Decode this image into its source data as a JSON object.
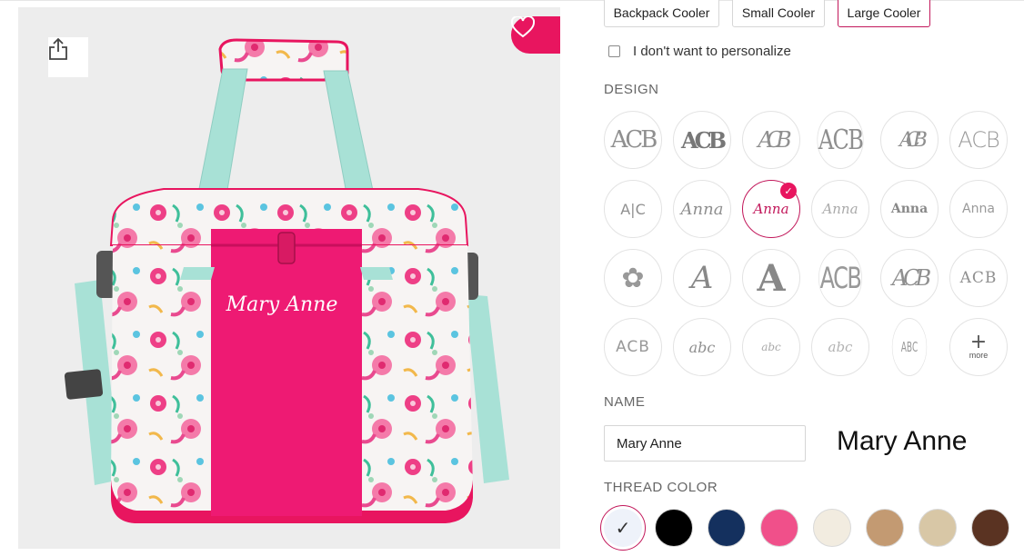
{
  "product_image": {
    "personalized_text": "Mary Anne"
  },
  "size_options": [
    {
      "label": "Backpack Cooler",
      "selected": false
    },
    {
      "label": "Small Cooler",
      "selected": false
    },
    {
      "label": "Large Cooler",
      "selected": true
    }
  ],
  "personalize": {
    "label": "I don't want to personalize",
    "checked": false
  },
  "design": {
    "label": "DESIGN",
    "options": [
      {
        "text": "ACB",
        "icon": "monogram-serif-icon"
      },
      {
        "text": "ACB",
        "icon": "monogram-bold-icon"
      },
      {
        "text": "ACB",
        "icon": "monogram-interlock-icon"
      },
      {
        "text": "ACB",
        "icon": "monogram-tall-icon"
      },
      {
        "text": "ACB",
        "icon": "monogram-vine-icon"
      },
      {
        "text": "ACB",
        "icon": "monogram-thin-icon"
      },
      {
        "text": "A|C",
        "icon": "monogram-split-icon"
      },
      {
        "text": "Anna",
        "icon": "script-anna-icon"
      },
      {
        "text": "Anna",
        "icon": "script-anna-selected-icon",
        "selected": true
      },
      {
        "text": "Anna",
        "icon": "script-thin-anna-icon"
      },
      {
        "text": "Anna",
        "icon": "serif-anna-icon"
      },
      {
        "text": "Anna",
        "icon": "print-anna-icon"
      },
      {
        "text": "✿",
        "icon": "flourish-icon"
      },
      {
        "text": "A",
        "icon": "script-initial-icon"
      },
      {
        "text": "A",
        "icon": "block-initial-icon"
      },
      {
        "text": "ACB",
        "icon": "monogram-outline-icon"
      },
      {
        "text": "ACB",
        "icon": "monogram-loop-icon"
      },
      {
        "text": "ACB",
        "icon": "monogram-smallcaps-icon"
      },
      {
        "text": "ACB",
        "icon": "monogram-block-icon"
      },
      {
        "text": "abc",
        "icon": "script-abc-icon"
      },
      {
        "text": "abc",
        "icon": "small-abc-icon"
      },
      {
        "text": "abc",
        "icon": "light-abc-icon"
      },
      {
        "text": "ABC",
        "icon": "condensed-abc-icon"
      },
      {
        "text": "more",
        "icon": "plus-icon"
      }
    ]
  },
  "name": {
    "label": "NAME",
    "value": "Mary Anne",
    "preview": "Mary Anne"
  },
  "thread_color": {
    "label": "THREAD COLOR",
    "swatches": [
      {
        "color": "#eef2fa",
        "selected": true
      },
      {
        "color": "#000000",
        "selected": false
      },
      {
        "color": "#14305e",
        "selected": false
      },
      {
        "color": "#f0508a",
        "selected": false
      },
      {
        "color": "#f2ece0",
        "selected": false
      },
      {
        "color": "#c39a72",
        "selected": false
      },
      {
        "color": "#d8c7a6",
        "selected": false
      },
      {
        "color": "#5a3322",
        "selected": false
      }
    ]
  },
  "colors": {
    "accent": "#e8155f",
    "selected_border": "#c2185b"
  }
}
